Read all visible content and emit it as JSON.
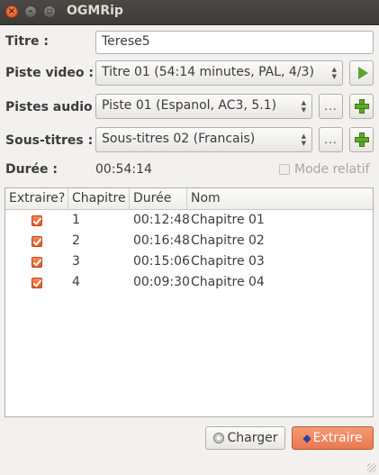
{
  "window": {
    "title": "OGMRip"
  },
  "form": {
    "titre_label": "Titre :",
    "titre_value": "Terese5",
    "video_label": "Piste video :",
    "video_value": "Titre 01 (54:14 minutes, PAL, 4/3)",
    "audio_label": "Pistes audio :",
    "audio_value": "Piste 01 (Espanol, AC3, 5.1)",
    "subs_label": "Sous-titres :",
    "subs_value": "Sous-titres 02 (Francais)",
    "more_label": "...",
    "duree_label": "Durée :",
    "duree_value": "00:54:14",
    "mode_relatif_label": "Mode relatif",
    "mode_relatif_checked": false
  },
  "table": {
    "headers": [
      "Extraire?",
      "Chapitre",
      "Durée",
      "Nom"
    ],
    "rows": [
      {
        "extract": true,
        "chapter": "1",
        "duration": "00:12:48",
        "name": "Chapitre 01"
      },
      {
        "extract": true,
        "chapter": "2",
        "duration": "00:16:48",
        "name": "Chapitre 02"
      },
      {
        "extract": true,
        "chapter": "3",
        "duration": "00:15:06",
        "name": "Chapitre 03"
      },
      {
        "extract": true,
        "chapter": "4",
        "duration": "00:09:30",
        "name": "Chapitre 04"
      }
    ]
  },
  "buttons": {
    "load_label": "Charger",
    "extract_label": "Extraire"
  },
  "icons": {
    "play": "play-icon",
    "add": "plus-icon",
    "disc": "disc-icon",
    "extract": "extract-icon"
  },
  "colors": {
    "accent": "#e9764d",
    "play_green": "#58a62a",
    "add_green": "#5fa829",
    "titlebar": "#3c3b37"
  }
}
